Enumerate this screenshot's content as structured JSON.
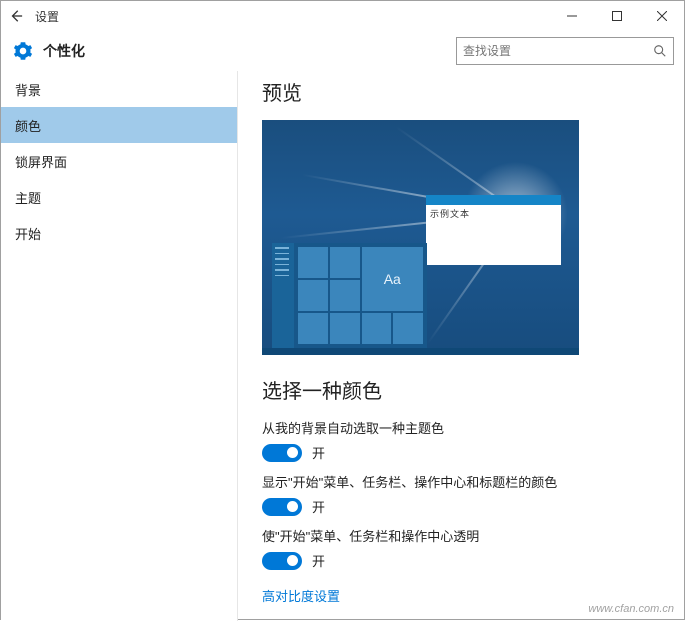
{
  "window": {
    "title": "设置"
  },
  "header": {
    "page_title": "个性化"
  },
  "search": {
    "placeholder": "查找设置"
  },
  "sidebar": {
    "items": [
      {
        "label": "背景"
      },
      {
        "label": "颜色"
      },
      {
        "label": "锁屏界面"
      },
      {
        "label": "主题"
      },
      {
        "label": "开始"
      }
    ],
    "selected_index": 1
  },
  "content": {
    "preview_heading": "预览",
    "preview_sample_text": "示例文本",
    "preview_tile_text": "Aa",
    "choose_color_heading": "选择一种颜色",
    "options": [
      {
        "label": "从我的背景自动选取一种主题色",
        "on": true,
        "on_text": "开"
      },
      {
        "label": "显示\"开始\"菜单、任务栏、操作中心和标题栏的颜色",
        "on": true,
        "on_text": "开"
      },
      {
        "label": "使\"开始\"菜单、任务栏和操作中心透明",
        "on": true,
        "on_text": "开"
      }
    ],
    "high_contrast_link": "高对比度设置"
  },
  "colors": {
    "accent": "#0078d7"
  },
  "watermark": "www.cfan.com.cn"
}
